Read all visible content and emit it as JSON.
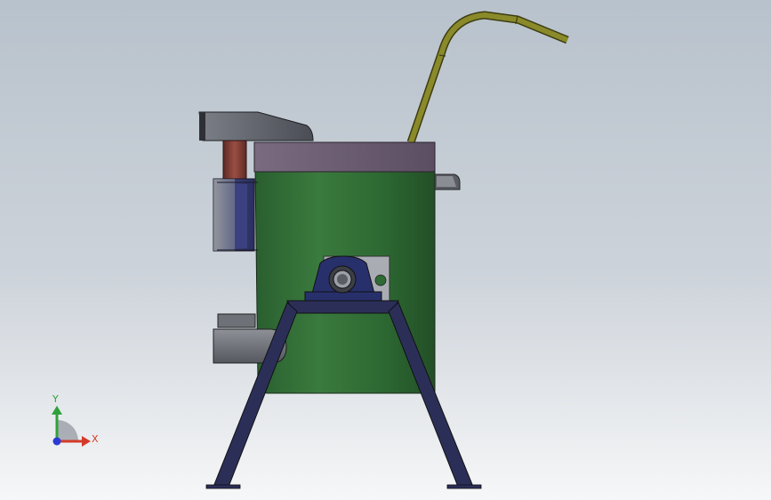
{
  "viewport": {
    "background_top": "#b8c2cc",
    "background_bottom": "#f6f7f8"
  },
  "model": {
    "parts": [
      {
        "name": "barrel-body",
        "color": "#2f6a34"
      },
      {
        "name": "top-lid",
        "color": "#6b5b72"
      },
      {
        "name": "feed-pipe",
        "color": "#8a8a2a"
      },
      {
        "name": "hopper-chute",
        "color": "#5a5d66"
      },
      {
        "name": "side-motor",
        "color": "#3a3f78"
      },
      {
        "name": "coupling-shaft",
        "color": "#7a3b34"
      },
      {
        "name": "bearing-block",
        "color": "#28306b"
      },
      {
        "name": "stand-frame",
        "color": "#2b2f58"
      },
      {
        "name": "discharge-outlet",
        "color": "#6a6d72"
      }
    ]
  },
  "triad": {
    "x_label": "X",
    "y_label": "Y",
    "x_color": "#d43a2a",
    "y_color": "#2fa13a",
    "z_color": "#2a3ad4"
  }
}
